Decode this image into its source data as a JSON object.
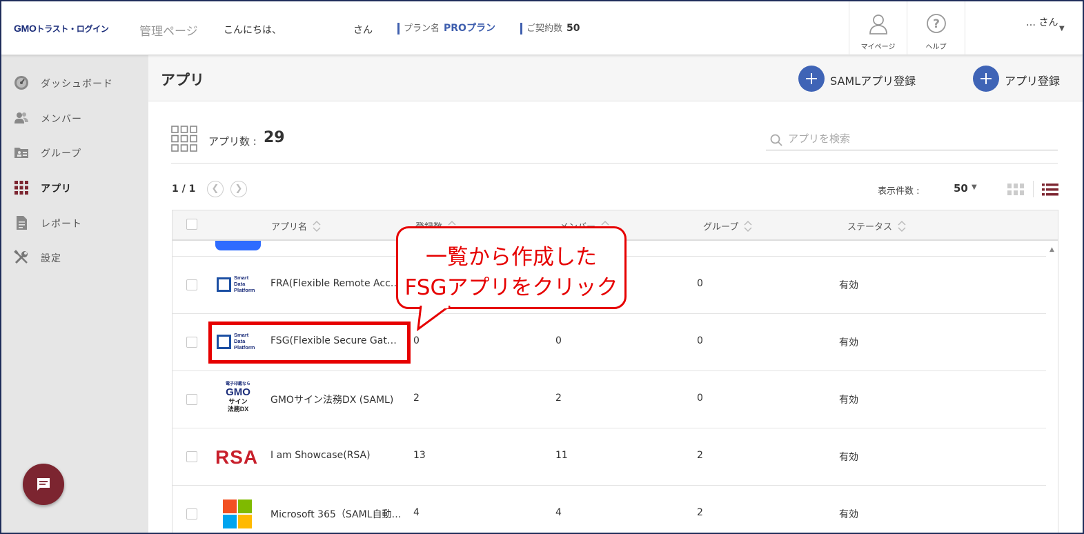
{
  "header": {
    "logo_gmo": "GMO",
    "logo_rest": "トラスト・ログイン",
    "admin_title": "管理ページ",
    "greeting": "こんにちは、",
    "greeting_suffix": "さん",
    "plan_label": "プラン名",
    "plan_value": "PROプラン",
    "contract_label": "ご契約数",
    "contract_value": "50",
    "mypage_label": "マイページ",
    "help_label": "ヘルプ",
    "user_name": "… さん"
  },
  "sidebar": {
    "items": [
      {
        "label": "ダッシュボード",
        "icon": "dashboard-icon"
      },
      {
        "label": "メンバー",
        "icon": "members-icon"
      },
      {
        "label": "グループ",
        "icon": "group-icon"
      },
      {
        "label": "アプリ",
        "icon": "apps-icon",
        "active": true
      },
      {
        "label": "レポート",
        "icon": "report-icon"
      },
      {
        "label": "設定",
        "icon": "settings-icon"
      }
    ]
  },
  "main": {
    "title": "アプリ",
    "saml_button": "SAMLアプリ登録",
    "add_button": "アプリ登録",
    "count_label": "アプリ数 :",
    "count_value": "29",
    "search_placeholder": "アプリを検索",
    "pager": "1 / 1",
    "display_label": "表示件数 :",
    "display_value": "50"
  },
  "table": {
    "headers": [
      "アプリ名",
      "登録数",
      "メンバー",
      "グループ",
      "ステータス"
    ],
    "rows": [
      {
        "logo": "smart-data-platform-logo",
        "name": "FRA(Flexible Remote Acce…",
        "registered": "",
        "members": "",
        "groups": "0",
        "status": "有効"
      },
      {
        "logo": "smart-data-platform-logo",
        "name": "FSG(Flexible Secure Gatew…",
        "registered": "0",
        "members": "0",
        "groups": "0",
        "status": "有効"
      },
      {
        "logo": "gmo-sign-logo",
        "name": "GMOサイン法務DX (SAML)",
        "registered": "2",
        "members": "2",
        "groups": "0",
        "status": "有効"
      },
      {
        "logo": "rsa-logo",
        "name": "I am Showcase(RSA)",
        "registered": "13",
        "members": "11",
        "groups": "2",
        "status": "有効"
      },
      {
        "logo": "microsoft-logo",
        "name": "Microsoft 365（SAML自動…",
        "registered": "4",
        "members": "4",
        "groups": "2",
        "status": "有効"
      }
    ]
  },
  "logos": {
    "sdp_lines": [
      "Smart",
      "Data",
      "Platform"
    ],
    "gmo_sign_top": "電子印鑑なら",
    "gmo_sign_mid": "GMO",
    "gmo_sign_sub": "サイン",
    "gmo_sign_bottom": "法務DX",
    "rsa": "RSA"
  },
  "annotation": {
    "line1": "一覧から作成した",
    "line2": "FSGアプリをクリック",
    "color": "#e60000"
  },
  "colors": {
    "accent": "#3f64b6",
    "sidebar_bg": "#e6e6e6",
    "chat_button": "#7c2530",
    "active_icon": "#7c2530"
  }
}
